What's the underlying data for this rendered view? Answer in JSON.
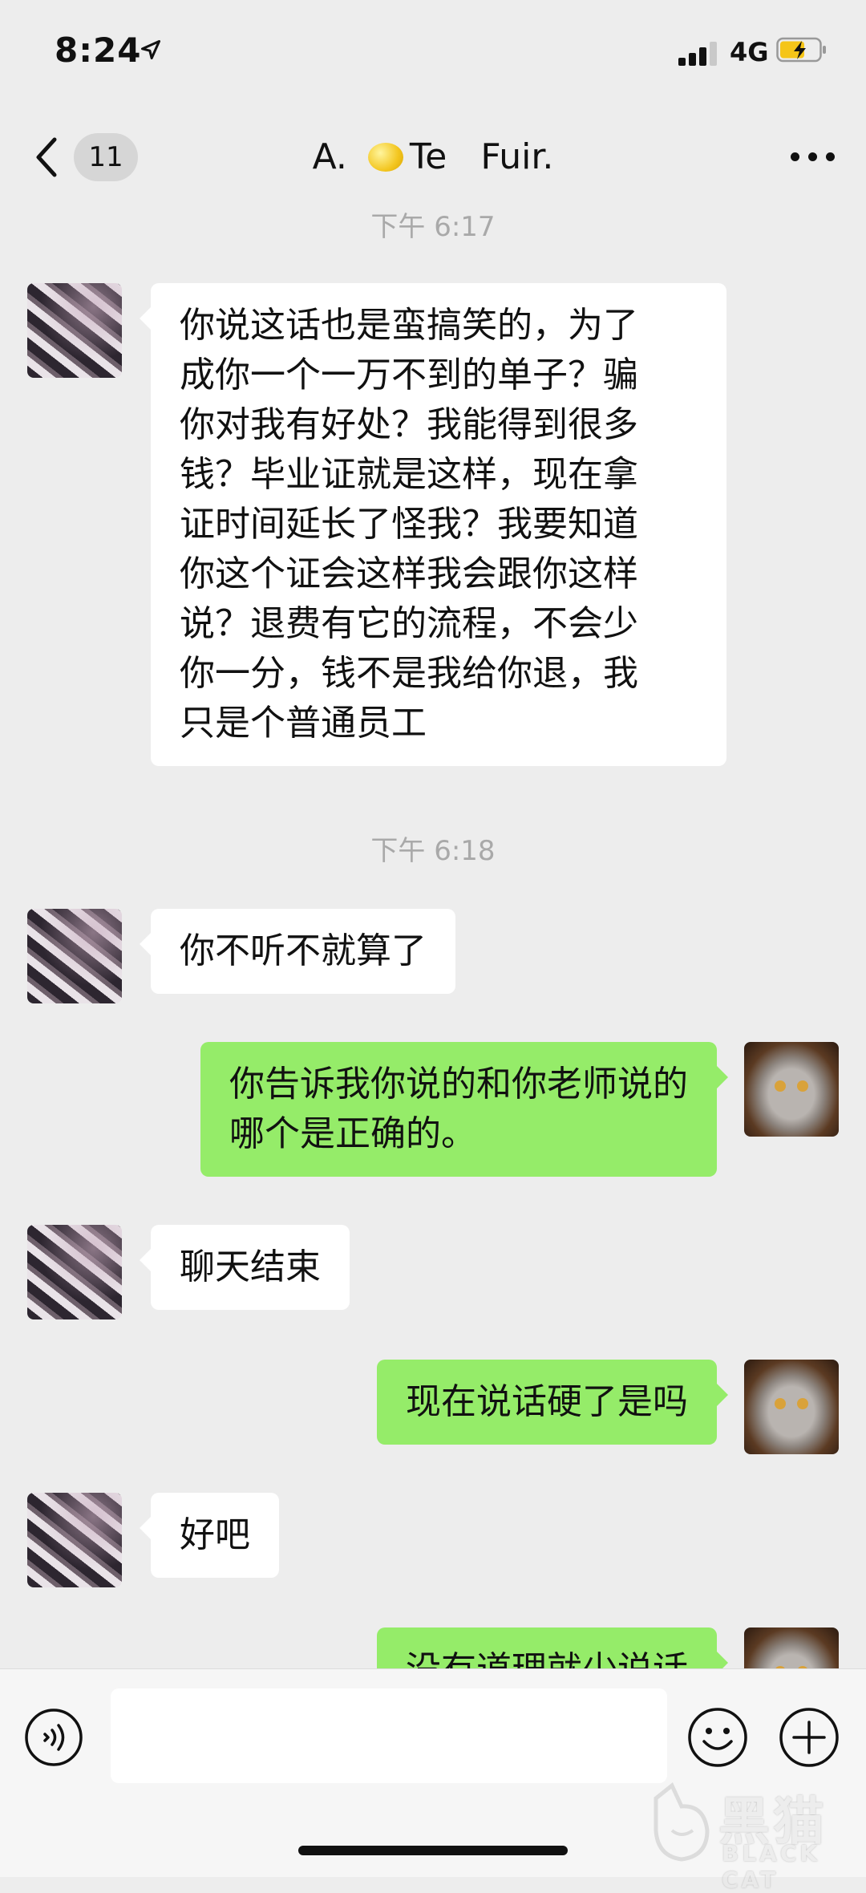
{
  "status_bar": {
    "time": "8:24",
    "network": "4G",
    "location_icon": "location-arrow-icon",
    "signal_icon": "signal-bars-icon",
    "battery_icon": "battery-charging-icon"
  },
  "nav": {
    "back_icon": "chevron-left-icon",
    "unread_count": "11",
    "title_prefix": "A.",
    "title_emoji_icon": "lemon-emoji",
    "title_suffix": "Te   Fuir.",
    "more_icon": "more-dots-icon"
  },
  "messages": [
    {
      "type": "timestamp",
      "text": "下午 6:17"
    },
    {
      "type": "in",
      "lines": [
        "你说这话也是蛮搞笑的，为了",
        "成你一个一万不到的单子？骗",
        "你对我有好处？我能得到很多",
        "钱？毕业证就是这样，现在拿",
        "证时间延长了怪我？我要知道",
        "你这个证会这样我会跟你这样",
        "说？退费有它的流程，不会少",
        "你一分，钱不是我给你退，我",
        "只是个普通员工"
      ]
    },
    {
      "type": "timestamp",
      "text": "下午 6:18"
    },
    {
      "type": "in",
      "lines": [
        "你不听不就算了"
      ]
    },
    {
      "type": "out",
      "lines": [
        "你告诉我你说的和你老师说的",
        "哪个是正确的。"
      ]
    },
    {
      "type": "in",
      "lines": [
        "聊天结束"
      ]
    },
    {
      "type": "out",
      "lines": [
        "现在说话硬了是吗"
      ]
    },
    {
      "type": "in",
      "lines": [
        "好吧"
      ]
    },
    {
      "type": "out",
      "lines": [
        "没有道理就少说话"
      ]
    }
  ],
  "input_bar": {
    "voice_icon": "voice-wave-icon",
    "emoji_icon": "smiley-icon",
    "plus_icon": "plus-circle-icon",
    "text_value": ""
  },
  "watermark": {
    "chinese": "黑猫",
    "english": "BLACK CAT"
  },
  "colors": {
    "background": "#ededed",
    "outgoing_bubble": "#95ec69",
    "incoming_bubble": "#ffffff",
    "timestamp_text": "#a9a9a9"
  }
}
